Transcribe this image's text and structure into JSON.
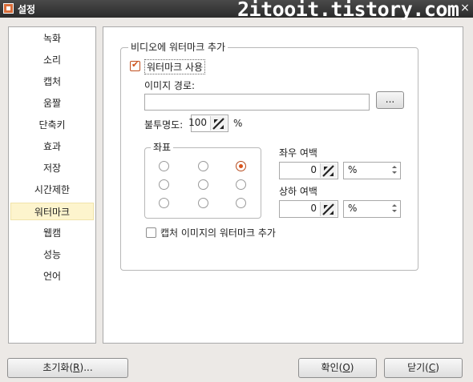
{
  "window": {
    "title": "설정",
    "watermark": "2itooit.tistory.com",
    "close": "×"
  },
  "sidebar": {
    "items": [
      {
        "label": "녹화"
      },
      {
        "label": "소리"
      },
      {
        "label": "캡처"
      },
      {
        "label": "움짤"
      },
      {
        "label": "단축키"
      },
      {
        "label": "효과"
      },
      {
        "label": "저장"
      },
      {
        "label": "시간제한"
      },
      {
        "label": "워터마크",
        "selected": true
      },
      {
        "label": "웹캠"
      },
      {
        "label": "성능"
      },
      {
        "label": "언어"
      }
    ]
  },
  "watermark": {
    "group_title": "비디오에 워터마크 추가",
    "use_label": "워터마크 사용",
    "use_checked": true,
    "image_path_label": "이미지 경로:",
    "image_path_value": "",
    "browse_label": "...",
    "opacity_label": "불투명도:",
    "opacity_value": "100",
    "opacity_unit": "%",
    "coords_title": "좌표",
    "coords_selected": "top-right",
    "margin_lr_label": "좌우 여백",
    "margin_lr_value": "0",
    "margin_lr_unit": "%",
    "margin_tb_label": "상하 여백",
    "margin_tb_value": "0",
    "margin_tb_unit": "%",
    "capture_label": "캡처 이미지의 워터마크 추가",
    "capture_checked": false
  },
  "footer": {
    "reset": {
      "label": "초기화",
      "mnemonic": "R",
      "suffix": "..."
    },
    "ok": {
      "label": "확인",
      "mnemonic": "O"
    },
    "close": {
      "label": "닫기",
      "mnemonic": "C"
    }
  },
  "colors": {
    "accent": "#d9541c",
    "selection": "#fdf4cd"
  }
}
